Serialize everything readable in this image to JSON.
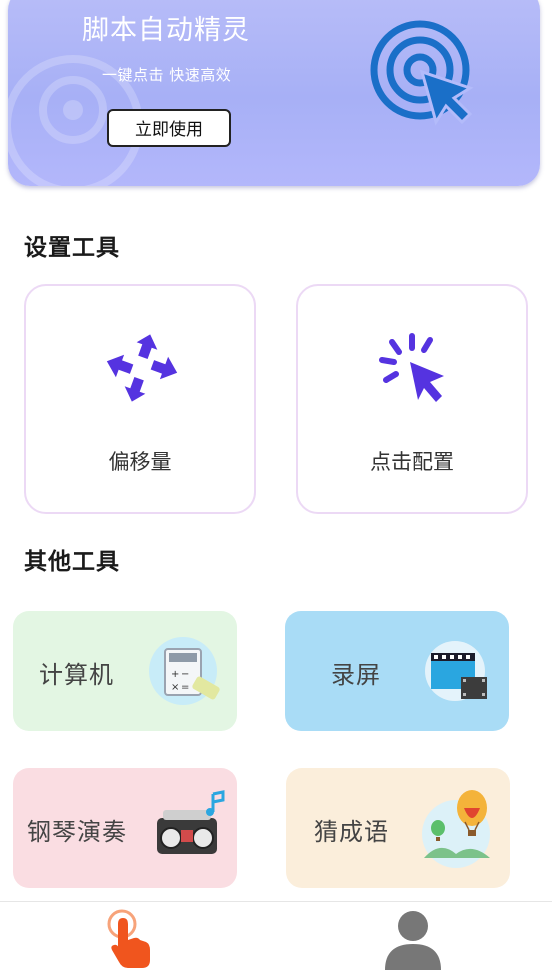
{
  "banner": {
    "title": "脚本自动精灵",
    "subtitle": "一键点击  快速高效",
    "button_label": "立即使用"
  },
  "settings_tools": {
    "heading": "设置工具",
    "items": [
      {
        "label": "偏移量",
        "icon": "move-arrows-icon"
      },
      {
        "label": "点击配置",
        "icon": "click-cursor-icon"
      }
    ]
  },
  "other_tools": {
    "heading": "其他工具",
    "items": [
      {
        "label": "计算机",
        "icon": "calculator-icon",
        "color": "#e3f6e3"
      },
      {
        "label": "录屏",
        "icon": "screen-record-icon",
        "color": "#a9dcf6"
      },
      {
        "label": "钢琴演奏",
        "icon": "radio-music-icon",
        "color": "#fadde2"
      },
      {
        "label": "猜成语",
        "icon": "hot-air-balloon-icon",
        "color": "#fbeedb"
      }
    ]
  },
  "bottom_nav": {
    "items": [
      {
        "name": "home",
        "icon": "tap-hand-icon",
        "active": true,
        "color": "#f0551e"
      },
      {
        "name": "profile",
        "icon": "user-icon",
        "active": false,
        "color": "#777777"
      }
    ]
  },
  "colors": {
    "accent": "#5533e0",
    "banner": "#a9b0f7"
  }
}
